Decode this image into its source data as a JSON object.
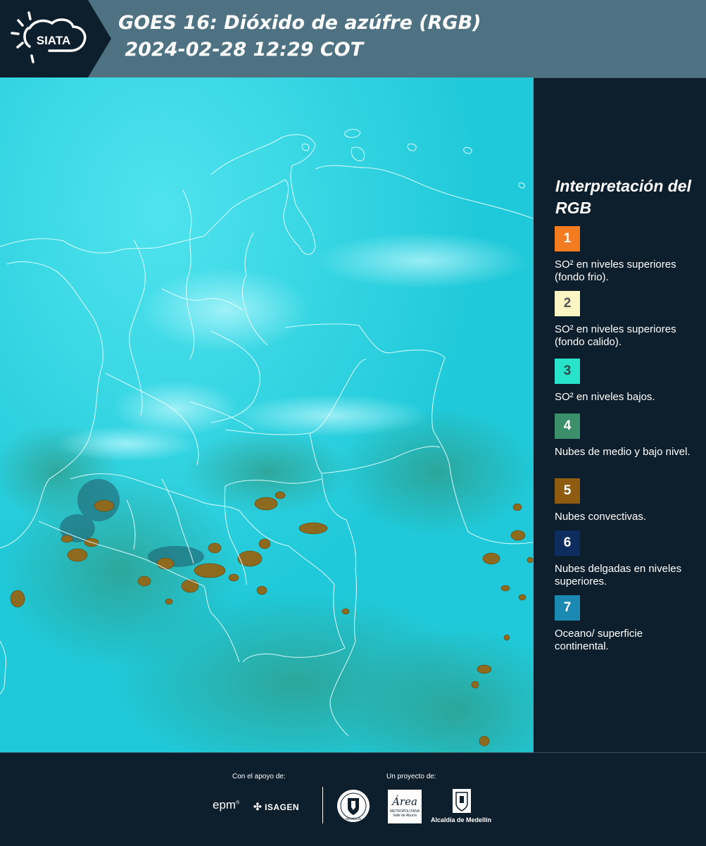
{
  "header": {
    "logo_text": "SIATA",
    "title_line1": "GOES 16: Dióxido de azúfre (RGB)",
    "title_line2": " 2024-02-28 12:29 COT"
  },
  "legend": {
    "title": "Interpretación del RGB",
    "items": [
      {
        "number": "1",
        "color": "#f47c20",
        "text_color": "#ffffff",
        "label": "SO² en niveles superiores (fondo frio)."
      },
      {
        "number": "2",
        "color": "#fdf6c4",
        "text_color": "#555555",
        "label": "SO² en niveles superiores (fondo calido)."
      },
      {
        "number": "3",
        "color": "#27e3c9",
        "text_color": "#2f4b50",
        "label": "SO² en niveles bajos."
      },
      {
        "number": "4",
        "color": "#3b8f6a",
        "text_color": "#ffffff",
        "label": "Nubes de medio y bajo nivel."
      },
      {
        "number": "5",
        "color": "#8e5b11",
        "text_color": "#ffffff",
        "label": "Nubes convectivas."
      },
      {
        "number": "6",
        "color": "#0d2d5e",
        "text_color": "#ffffff",
        "label": "Nubes delgadas en niveles superiores."
      },
      {
        "number": "7",
        "color": "#1a8ab3",
        "text_color": "#ffffff",
        "label": "Oceano/ superficie continental."
      }
    ]
  },
  "footer": {
    "support_label": "Con el apoyo de:",
    "project_label": "Un proyecto de:",
    "sponsor_epm": "epm",
    "sponsor_isagen": "ISAGEN",
    "partner_area_line1": "Área",
    "partner_area_line2": "METROPOLITANA",
    "partner_area_line3": "Valle de Aburrá",
    "partner_alcaldia": "Alcaldía de Medellín",
    "seal_text": "MEDELLÍN"
  },
  "map": {
    "type": "satellite-rgb-composite",
    "colors": {
      "background": "#1cc7d9",
      "convective": "#8e6a1e"
    }
  }
}
